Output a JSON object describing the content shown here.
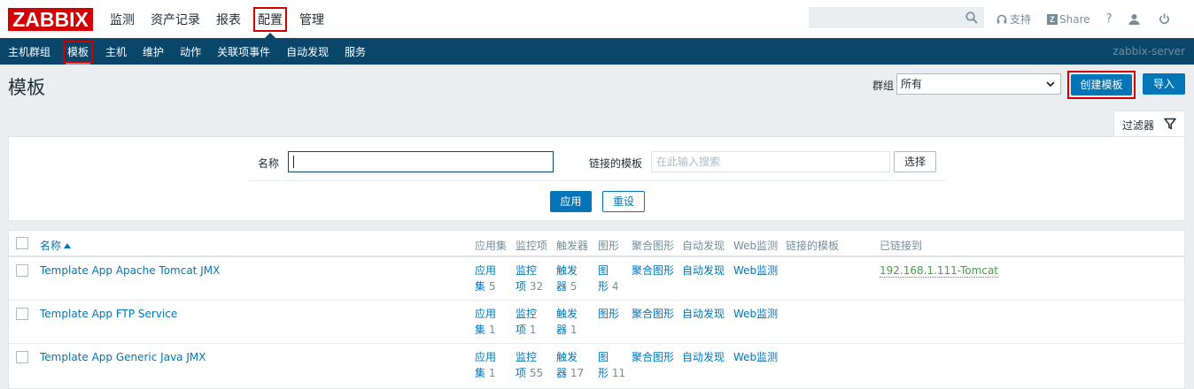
{
  "logo": "ZABBIX",
  "top_nav": [
    "监测",
    "资产记录",
    "报表",
    "配置",
    "管理"
  ],
  "top_right": {
    "support": "支持",
    "share_badge": "Z",
    "share": "Share",
    "help": "?"
  },
  "sub_nav": [
    "主机群组",
    "模板",
    "主机",
    "维护",
    "动作",
    "关联项事件",
    "自动发现",
    "服务"
  ],
  "server_name": "zabbix-server",
  "page": {
    "title": "模板",
    "group_label": "群组",
    "group_value": "所有",
    "create_button": "创建模板",
    "import_button": "导入"
  },
  "filter": {
    "tab_label": "过滤器",
    "name_label": "名称",
    "name_value": "",
    "linked_label": "链接的模板",
    "linked_placeholder": "在此输入搜索",
    "select_button": "选择",
    "apply_button": "应用",
    "reset_button": "重设"
  },
  "table": {
    "headers": {
      "name": "名称",
      "apps": "应用集",
      "items": "监控项",
      "triggers": "触发器",
      "graphs": "图形",
      "screens": "聚合图形",
      "discovery": "自动发现",
      "web": "Web监测",
      "linked": "链接的模板",
      "linked_to": "已链接到"
    },
    "rows": [
      {
        "name": "Template App Apache Tomcat JMX",
        "apps_l1": "应用",
        "apps_l2": "集",
        "apps_n": "5",
        "items_l1": "监控",
        "items_l2": "项",
        "items_n": "32",
        "trig_l1": "触发",
        "trig_l2": "器",
        "trig_n": "5",
        "graph_l1": "图",
        "graph_l2": "形",
        "graph_n": "4",
        "screens": "聚合图形",
        "discovery": "自动发现",
        "web": "Web监测",
        "linked_to": "192.168.1.111-Tomcat"
      },
      {
        "name": "Template App FTP Service",
        "apps_l1": "应用",
        "apps_l2": "集",
        "apps_n": "1",
        "items_l1": "监控",
        "items_l2": "项",
        "items_n": "1",
        "trig_l1": "触发",
        "trig_l2": "器",
        "trig_n": "1",
        "graph": "图形",
        "screens": "聚合图形",
        "discovery": "自动发现",
        "web": "Web监测"
      },
      {
        "name": "Template App Generic Java JMX",
        "apps_l1": "应用",
        "apps_l2": "集",
        "apps_n": "1",
        "items_l1": "监控",
        "items_l2": "项",
        "items_n": "55",
        "trig_l1": "触发",
        "trig_l2": "器",
        "trig_n": "17",
        "graph_l1": "图",
        "graph_l2": "形",
        "graph_n": "11",
        "screens": "聚合图形",
        "discovery": "自动发现",
        "web": "Web监测"
      }
    ]
  }
}
